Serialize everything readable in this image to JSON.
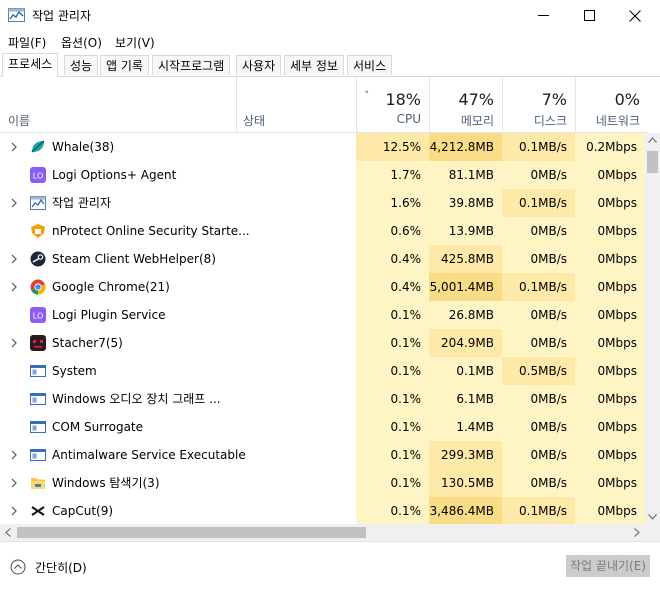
{
  "window": {
    "title": "작업 관리자",
    "controls": {
      "minimize": "—",
      "maximize": "☐",
      "close": "✕"
    }
  },
  "menu": [
    "파일(F)",
    "옵션(O)",
    "보기(V)"
  ],
  "tabs": [
    "프로세스",
    "성능",
    "앱 기록",
    "시작프로그램",
    "사용자",
    "세부 정보",
    "서비스"
  ],
  "active_tab": "프로세스",
  "header": {
    "name_label": "이름",
    "status_label": "상태",
    "sort_indicator": "˅",
    "cpu": {
      "pct": "18%",
      "label": "CPU"
    },
    "memory": {
      "pct": "47%",
      "label": "메모리"
    },
    "disk": {
      "pct": "7%",
      "label": "디스크"
    },
    "network": {
      "pct": "0%",
      "label": "네트워크"
    }
  },
  "processes": [
    {
      "name": "Whale(38)",
      "expandable": true,
      "icon": "whale-icon",
      "cpu": "12.5%",
      "mem": "4,212.8MB",
      "disk": "0.1MB/s",
      "net": "0.2Mbps"
    },
    {
      "name": "Logi Options+ Agent",
      "expandable": false,
      "icon": "logi-icon",
      "cpu": "1.7%",
      "mem": "81.1MB",
      "disk": "0MB/s",
      "net": "0Mbps"
    },
    {
      "name": "작업 관리자",
      "expandable": true,
      "icon": "task-manager-icon",
      "cpu": "1.6%",
      "mem": "39.8MB",
      "disk": "0.1MB/s",
      "net": "0Mbps"
    },
    {
      "name": "nProtect Online Security Starte...",
      "expandable": false,
      "icon": "nprotect-icon",
      "cpu": "0.6%",
      "mem": "13.9MB",
      "disk": "0MB/s",
      "net": "0Mbps"
    },
    {
      "name": "Steam Client WebHelper(8)",
      "expandable": true,
      "icon": "steam-icon",
      "cpu": "0.4%",
      "mem": "425.8MB",
      "disk": "0MB/s",
      "net": "0Mbps"
    },
    {
      "name": "Google Chrome(21)",
      "expandable": true,
      "icon": "chrome-icon",
      "cpu": "0.4%",
      "mem": "5,001.4MB",
      "disk": "0.1MB/s",
      "net": "0Mbps"
    },
    {
      "name": "Logi Plugin Service",
      "expandable": false,
      "icon": "logi-icon",
      "cpu": "0.1%",
      "mem": "26.8MB",
      "disk": "0MB/s",
      "net": "0Mbps"
    },
    {
      "name": "Stacher7(5)",
      "expandable": true,
      "icon": "stacher-icon",
      "cpu": "0.1%",
      "mem": "204.9MB",
      "disk": "0MB/s",
      "net": "0Mbps"
    },
    {
      "name": "System",
      "expandable": false,
      "icon": "system-window-icon",
      "cpu": "0.1%",
      "mem": "0.1MB",
      "disk": "0.5MB/s",
      "net": "0Mbps"
    },
    {
      "name": "Windows 오디오 장치 그래프 ...",
      "expandable": false,
      "icon": "system-window-icon",
      "cpu": "0.1%",
      "mem": "6.1MB",
      "disk": "0MB/s",
      "net": "0Mbps"
    },
    {
      "name": "COM Surrogate",
      "expandable": false,
      "icon": "system-window-icon",
      "cpu": "0.1%",
      "mem": "1.4MB",
      "disk": "0MB/s",
      "net": "0Mbps"
    },
    {
      "name": "Antimalware Service Executable",
      "expandable": true,
      "icon": "system-window-icon",
      "cpu": "0.1%",
      "mem": "299.3MB",
      "disk": "0MB/s",
      "net": "0Mbps"
    },
    {
      "name": "Windows 탐색기(3)",
      "expandable": true,
      "icon": "folder-icon",
      "cpu": "0.1%",
      "mem": "130.5MB",
      "disk": "0MB/s",
      "net": "0Mbps"
    },
    {
      "name": "CapCut(9)",
      "expandable": true,
      "icon": "capcut-icon",
      "cpu": "0.1%",
      "mem": "3,486.4MB",
      "disk": "0.1MB/s",
      "net": "0Mbps"
    }
  ],
  "footer": {
    "fewer_details": "간단히(D)",
    "end_task": "작업 끝내기(E)"
  },
  "colors": {
    "heat_light": "#fff4c4",
    "heat_medium": "#ffe9a8",
    "heat_strong": "#f9dc86",
    "header_label": "#4c607a"
  }
}
